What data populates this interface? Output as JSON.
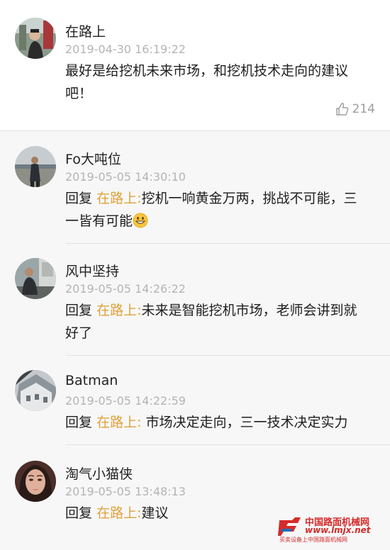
{
  "original_comment": {
    "name": "在路上",
    "time": "2019-04-30 16:19:22",
    "text": "最好是给挖机未来市场，和挖机技术走向的建议吧！",
    "likes": "214",
    "avatar_icon": "person-photo-avatar"
  },
  "replies": [
    {
      "name": "Fo大吨位",
      "time": "2019-05-05 14:30:10",
      "prefix": "回复",
      "target": "在路上:",
      "text": "挖机一响黄金万两，挑战不可能，三一皆有可能",
      "emoji": "grinning-face-emoji",
      "avatar_icon": "person-photo-avatar"
    },
    {
      "name": "风中坚持",
      "time": "2019-05-05 14:26:22",
      "prefix": "回复",
      "target": "在路上:",
      "text": "未来是智能挖机市场，老师会讲到就好了",
      "avatar_icon": "person-photo-avatar"
    },
    {
      "name": "Batman",
      "time": "2019-05-05 14:22:59",
      "prefix": "回复",
      "target": "在路上:",
      "text": " 市场决定走向，三一技术决定实力",
      "avatar_icon": "building-photo-avatar"
    },
    {
      "name": "淘气小猫侠",
      "time": "2019-05-05 13:48:13",
      "prefix": "回复",
      "target": "在路上:",
      "text": "建议",
      "avatar_icon": "woman-portrait-avatar"
    }
  ],
  "watermark": {
    "title": "中国路面机械网",
    "url": "www.lmjx.net",
    "subtitle": "买卖设备上中国路面机械网"
  },
  "colors": {
    "reply_target": "#e2a13a",
    "timestamp": "#b4b4b4",
    "reply_background": "#f7f7f7",
    "watermark": "#d62a2a"
  }
}
